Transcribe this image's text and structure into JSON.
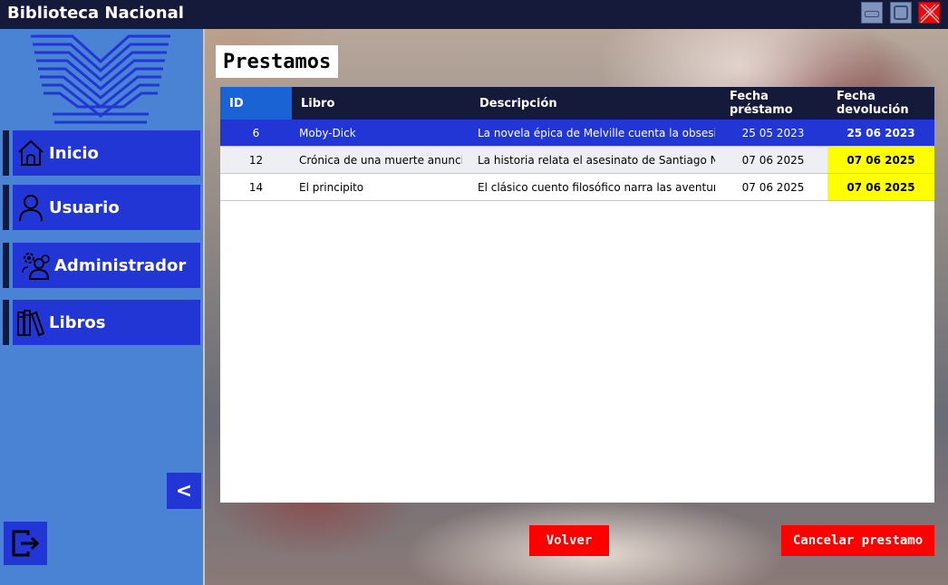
{
  "window": {
    "title": "Biblioteca Nacional"
  },
  "colors": {
    "titlebar": "#15193a",
    "sidebar": "#4a82d4",
    "nav_button": "#2236d6",
    "selected_row": "#2236d6",
    "overdue_highlight": "#ffff00",
    "action_button": "#ff0000"
  },
  "sidebar": {
    "items": [
      {
        "label": "Inicio",
        "icon": "home-icon"
      },
      {
        "label": "Usuario",
        "icon": "user-icon"
      },
      {
        "label": "Administrador",
        "icon": "admin-icon"
      },
      {
        "label": "Libros",
        "icon": "books-icon"
      }
    ],
    "collapse_label": "<"
  },
  "main": {
    "title": "Prestamos",
    "table": {
      "headers": [
        "ID",
        "Libro",
        "Descripción",
        "Fecha préstamo",
        "Fecha devolución"
      ],
      "rows": [
        {
          "id": "6",
          "libro": "Moby-Dick",
          "descripcion": "La novela épica de Melville cuenta la obsesió...",
          "prestamo": "25 05 2023",
          "devolucion": "25 06 2023"
        },
        {
          "id": "12",
          "libro": "Crónica de una muerte anunci...",
          "descripcion": "La historia relata el asesinato de Santiago N...",
          "prestamo": "07 06 2025",
          "devolucion": "07 06 2025"
        },
        {
          "id": "14",
          "libro": "El principito",
          "descripcion": "El clásico cuento filosófico narra las aventura...",
          "prestamo": "07 06 2025",
          "devolucion": "07 06 2025"
        }
      ]
    },
    "buttons": {
      "volver": "Volver",
      "cancelar": "Cancelar prestamo"
    }
  }
}
